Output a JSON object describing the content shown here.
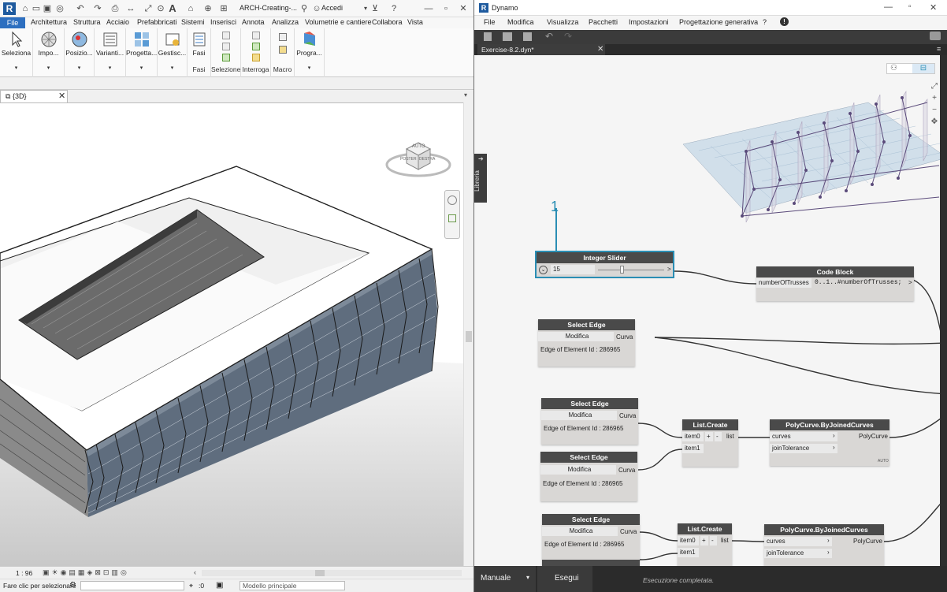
{
  "revit": {
    "qat": {
      "project": "ARCH-Creating-...",
      "signin": "Accedi"
    },
    "menu": [
      "File",
      "Architettura",
      "Struttura",
      "Acciaio",
      "Prefabbricati",
      "Sistemi",
      "Inserisci",
      "Annota",
      "Analizza",
      "Volumetrie e cantiere",
      "Collabora",
      "Vista"
    ],
    "ribbon": [
      "Seleziona",
      "Impo...",
      "Posizio...",
      "Varianti...",
      "Progetta...",
      "Gestisc...",
      "Fasi",
      "Selezione",
      "Interroga",
      "Macro",
      "Progra..."
    ],
    "panel_labels": {
      "fasi": "Fasi",
      "selezione": "Selezione",
      "interroga": "Interroga",
      "macro": "Macro"
    },
    "view_tab": "{3D}",
    "viewcube": {
      "top": "AUTO",
      "front": "DESTRA",
      "left": "POSTER"
    },
    "scale": "1 : 96",
    "status_text": "Fare clic per selezionare",
    "coord": ":0",
    "model": "Modello principale"
  },
  "dynamo": {
    "title": "Dynamo",
    "menu": [
      "File",
      "Modifica",
      "Visualizza",
      "Pacchetti",
      "Impostazioni",
      "Progettazione generativa",
      "?"
    ],
    "tab": "Exercise-8.2.dyn*",
    "library": "Libreria",
    "callout": "1",
    "nodes": {
      "slider": {
        "title": "Integer Slider",
        "value": "15",
        "out": ">"
      },
      "code": {
        "title": "Code Block",
        "in": "numberOfTrusses",
        "code": "0..1..#numberOfTrusses;",
        "out": ">"
      },
      "edge1": {
        "title": "Select Edge",
        "btn": "Modifica",
        "out": "Curva",
        "info": "Edge of Element Id : 286965"
      },
      "edge2": {
        "title": "Select Edge",
        "btn": "Modifica",
        "out": "Curva",
        "info": "Edge of Element Id : 286965"
      },
      "edge3": {
        "title": "Select Edge",
        "btn": "Modifica",
        "out": "Curva",
        "info": "Edge of Element Id : 286965"
      },
      "edge4": {
        "title": "Select Edge",
        "btn": "Modifica",
        "out": "Curva",
        "info": "Edge of Element Id : 286965"
      },
      "list1": {
        "title": "List.Create",
        "in0": "item0",
        "in1": "item1",
        "plus": "+",
        "minus": "-",
        "out": "list"
      },
      "list2": {
        "title": "List.Create",
        "in0": "item0",
        "in1": "item1",
        "plus": "+",
        "minus": "-",
        "out": "list"
      },
      "poly1": {
        "title": "PolyCurve.ByJoinedCurves",
        "in0": "curves",
        "in1": "joinTolerance",
        "out": "PolyCurve",
        "lacing": "AUTO"
      },
      "poly2": {
        "title": "PolyCurve.ByJoinedCurves",
        "in0": "curves",
        "in1": "joinTolerance",
        "out": "PolyCurve"
      }
    },
    "run_mode": "Manuale",
    "run_button": "Esegui",
    "status": "Esecuzione completata."
  }
}
